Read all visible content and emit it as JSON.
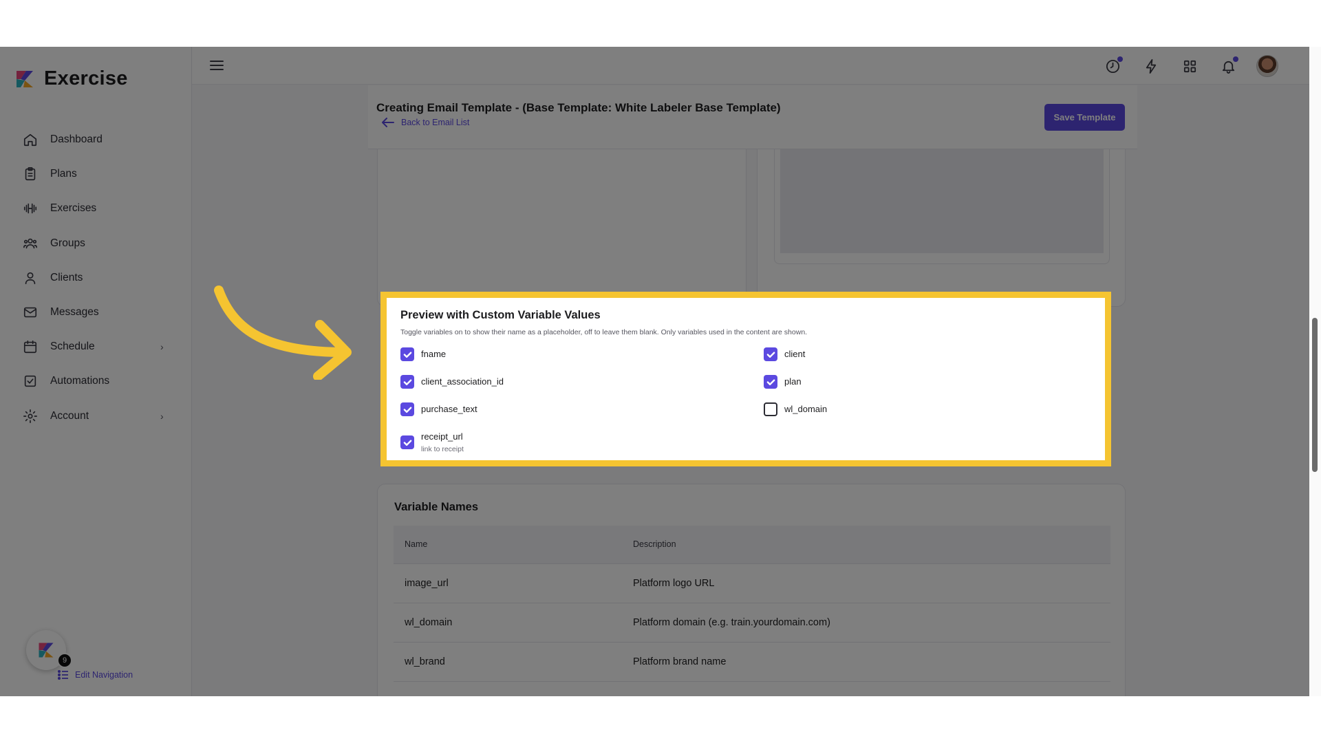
{
  "brand": {
    "name": "Exercise"
  },
  "sidebar": {
    "items": [
      {
        "label": "Dashboard",
        "icon": "home-icon"
      },
      {
        "label": "Plans",
        "icon": "clipboard-icon"
      },
      {
        "label": "Exercises",
        "icon": "dumbbell-icon"
      },
      {
        "label": "Groups",
        "icon": "users-icon"
      },
      {
        "label": "Clients",
        "icon": "user-icon"
      },
      {
        "label": "Messages",
        "icon": "mail-icon"
      },
      {
        "label": "Schedule",
        "icon": "calendar-icon"
      },
      {
        "label": "Automations",
        "icon": "check-square-icon"
      },
      {
        "label": "Account",
        "icon": "gear-icon"
      }
    ],
    "help_badge": "9",
    "edit_nav": "Edit Navigation"
  },
  "header": {
    "title": "Creating Email Template - (Base Template: White Labeler Base Template)",
    "back": "Back to Email List",
    "save": "Save Template"
  },
  "preview": {
    "title": "Preview with Custom Variable Values",
    "subtitle": "Toggle variables on to show their name as a placeholder, off to leave them blank. Only variables used in the content are shown.",
    "vars": [
      {
        "name": "fname",
        "checked": true,
        "hint": ""
      },
      {
        "name": "client",
        "checked": true,
        "hint": ""
      },
      {
        "name": "client_association_id",
        "checked": true,
        "hint": ""
      },
      {
        "name": "plan",
        "checked": true,
        "hint": ""
      },
      {
        "name": "purchase_text",
        "checked": true,
        "hint": ""
      },
      {
        "name": "wl_domain",
        "checked": false,
        "hint": ""
      },
      {
        "name": "receipt_url",
        "checked": true,
        "hint": "link to receipt"
      }
    ]
  },
  "variable_names": {
    "title": "Variable Names",
    "columns": [
      "Name",
      "Description"
    ],
    "rows": [
      {
        "name": "image_url",
        "description": "Platform logo URL"
      },
      {
        "name": "wl_domain",
        "description": "Platform domain (e.g. train.yourdomain.com)"
      },
      {
        "name": "wl_brand",
        "description": "Platform brand name"
      }
    ]
  },
  "colors": {
    "accent": "#5b49e0",
    "highlight": "#f5c431"
  }
}
